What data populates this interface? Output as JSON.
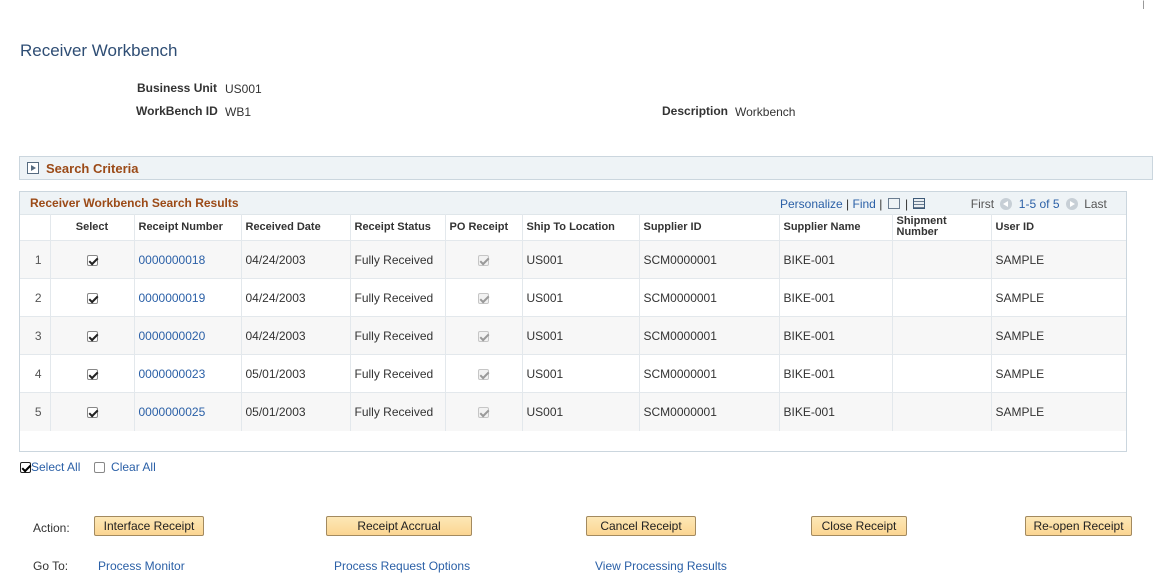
{
  "page": {
    "title": "Receiver Workbench"
  },
  "header": {
    "business_unit_label": "Business Unit",
    "business_unit_value": "US001",
    "workbench_id_label": "WorkBench ID",
    "workbench_id_value": "WB1",
    "description_label": "Description",
    "description_value": "Workbench"
  },
  "search_criteria": {
    "label": "Search Criteria"
  },
  "grid": {
    "title": "Receiver Workbench Search Results",
    "personalize": "Personalize",
    "find": "Find",
    "pager": {
      "first": "First",
      "range": "1-5 of 5",
      "last": "Last"
    },
    "columns": [
      "",
      "Select",
      "Receipt Number",
      "Received Date",
      "Receipt Status",
      "PO Receipt",
      "Ship To Location",
      "Supplier ID",
      "Supplier Name",
      "Shipment Number",
      "User ID"
    ],
    "rows": [
      {
        "num": "1",
        "selected": true,
        "receipt": "0000000018",
        "date": "04/24/2003",
        "status": "Fully Received",
        "po": true,
        "ship_to": "US001",
        "supplier_id": "SCM0000001",
        "supplier_name": "BIKE-001",
        "shipment": "",
        "user": "SAMPLE"
      },
      {
        "num": "2",
        "selected": true,
        "receipt": "0000000019",
        "date": "04/24/2003",
        "status": "Fully Received",
        "po": true,
        "ship_to": "US001",
        "supplier_id": "SCM0000001",
        "supplier_name": "BIKE-001",
        "shipment": "",
        "user": "SAMPLE"
      },
      {
        "num": "3",
        "selected": true,
        "receipt": "0000000020",
        "date": "04/24/2003",
        "status": "Fully Received",
        "po": true,
        "ship_to": "US001",
        "supplier_id": "SCM0000001",
        "supplier_name": "BIKE-001",
        "shipment": "",
        "user": "SAMPLE"
      },
      {
        "num": "4",
        "selected": true,
        "receipt": "0000000023",
        "date": "05/01/2003",
        "status": "Fully Received",
        "po": true,
        "ship_to": "US001",
        "supplier_id": "SCM0000001",
        "supplier_name": "BIKE-001",
        "shipment": "",
        "user": "SAMPLE"
      },
      {
        "num": "5",
        "selected": true,
        "receipt": "0000000025",
        "date": "05/01/2003",
        "status": "Fully Received",
        "po": true,
        "ship_to": "US001",
        "supplier_id": "SCM0000001",
        "supplier_name": "BIKE-001",
        "shipment": "",
        "user": "SAMPLE"
      }
    ]
  },
  "selection": {
    "select_all": "Select All",
    "clear_all": "Clear All"
  },
  "actions": {
    "label": "Action:",
    "interface_receipt": "Interface Receipt",
    "receipt_accrual": "Receipt Accrual",
    "cancel_receipt": "Cancel Receipt",
    "close_receipt": "Close Receipt",
    "reopen_receipt": "Re-open Receipt"
  },
  "goto": {
    "label": "Go To:",
    "process_monitor": "Process Monitor",
    "process_request_options": "Process Request Options",
    "view_processing_results": "View Processing Results"
  },
  "colors": {
    "title": "#2e4d74",
    "section_header": "#9b4a17",
    "link": "#2b60a7",
    "button_bg": "#fbd592"
  }
}
